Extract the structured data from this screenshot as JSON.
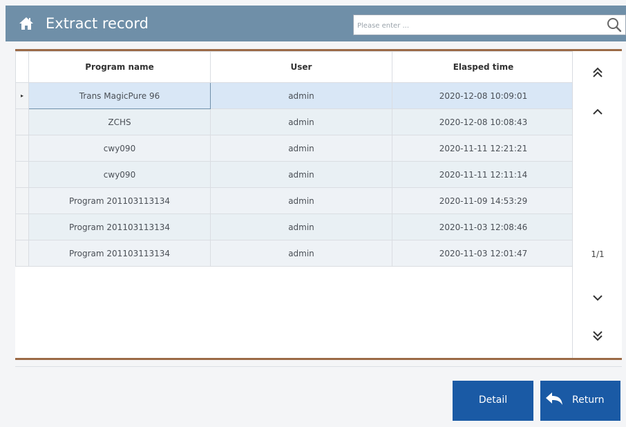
{
  "header": {
    "title": "Extract record",
    "search_placeholder": "Please enter ..."
  },
  "table": {
    "columns": [
      "Program name",
      "User",
      "Elasped time"
    ],
    "rows": [
      {
        "program": "Trans MagicPure 96",
        "user": "admin",
        "time": "2020-12-08 10:09:01"
      },
      {
        "program": "ZCHS",
        "user": "admin",
        "time": "2020-12-08 10:08:43"
      },
      {
        "program": "cwy090",
        "user": "admin",
        "time": "2020-11-11 12:21:21"
      },
      {
        "program": "cwy090",
        "user": "admin",
        "time": "2020-11-11 12:11:14"
      },
      {
        "program": "Program 201103113134",
        "user": "admin",
        "time": "2020-11-09 14:53:29"
      },
      {
        "program": "Program 201103113134",
        "user": "admin",
        "time": "2020-11-03 12:08:46"
      },
      {
        "program": "Program 201103113134",
        "user": "admin",
        "time": "2020-11-03 12:01:47"
      }
    ],
    "current_row_marker": "▸"
  },
  "pager": {
    "page": "1/1",
    "icons": [
      "double-chevron-up-icon",
      "chevron-up-icon",
      "chevron-down-icon",
      "double-chevron-down-icon"
    ]
  },
  "buttons": {
    "detail": "Detail",
    "return": "Return"
  },
  "colors": {
    "header_bg": "#6f8fa8",
    "accent_border": "#9b6a46",
    "button_bg": "#1a5aa5"
  }
}
